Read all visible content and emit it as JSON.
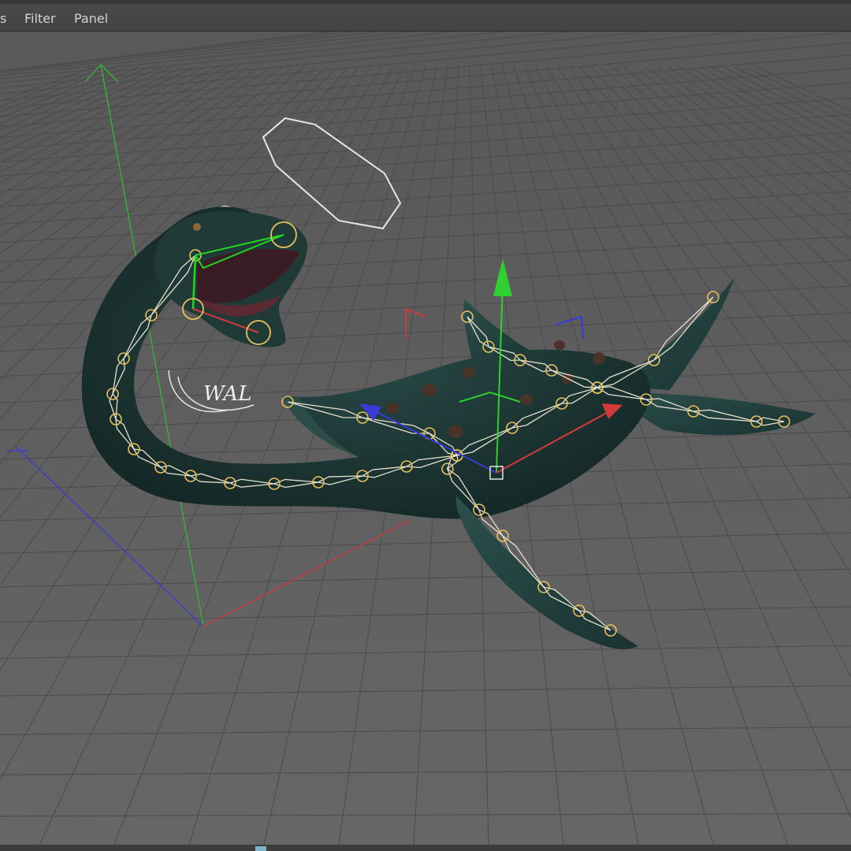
{
  "menubar": {
    "items": [
      {
        "label": "s"
      },
      {
        "label": "Filter"
      },
      {
        "label": "Panel"
      }
    ]
  },
  "viewport": {
    "annotation_text": "WAL",
    "colors": {
      "background": "#5c5c5c",
      "grid_line": "#4a4a4a",
      "axis_x": "#d23a3a",
      "axis_y": "#2fd02f",
      "axis_z": "#3a3ad8",
      "creature_body": "#1d3634",
      "creature_fin": "#23423f",
      "joint": "#e8c15a",
      "bone": "#e8e2d0"
    },
    "icons": [
      "world-axis-icon",
      "move-gizmo-icon",
      "rig-controller-icon"
    ]
  }
}
